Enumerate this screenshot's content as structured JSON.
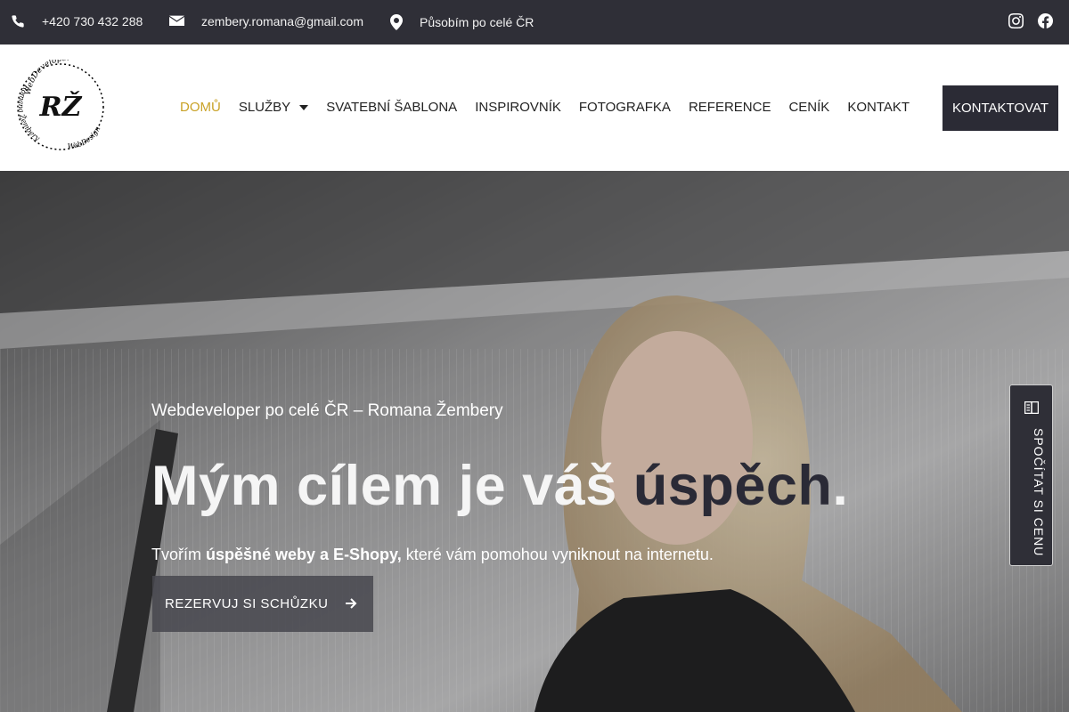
{
  "topbar": {
    "phone": "+420 730 432 288",
    "email": "zembery.romana@gmail.com",
    "location": "Působím po celé ČR",
    "social": [
      "instagram-icon",
      "facebook-icon"
    ]
  },
  "header": {
    "logo": {
      "initials": "RŽ",
      "ring_text_top": "WebDeveloper",
      "ring_text_left": "Romana Žembery",
      "ring_text_bottom": "WebDesign"
    },
    "nav": [
      {
        "label": "DOMŮ",
        "active": true
      },
      {
        "label": "SLUŽBY",
        "has_dropdown": true
      },
      {
        "label": "SVATEBNÍ ŠABLONA"
      },
      {
        "label": "INSPIROVNÍK"
      },
      {
        "label": "FOTOGRAFKA"
      },
      {
        "label": "REFERENCE"
      },
      {
        "label": "CENÍK"
      },
      {
        "label": "KONTAKT"
      }
    ],
    "cta": "KONTAKTOVAT"
  },
  "hero": {
    "subtitle": "Webdeveloper po celé ČR – Romana Žembery",
    "title_part1": "Mým cílem je váš ",
    "title_accent": "úspěch",
    "title_end": ".",
    "desc_pre": "Tvořím ",
    "desc_bold": "úspěšné weby a E-Shopy,",
    "desc_post": " které vám pomohou vyniknout na internetu.",
    "button": "REZERVUJ SI SCHŮZKU"
  },
  "side_button": {
    "label": "SPOČÍTAT SI CENU",
    "icon": "calculator-icon"
  },
  "colors": {
    "topbar": "#2f2f37",
    "accent_nav": "#c9a227",
    "dark": "#2b2b35"
  }
}
